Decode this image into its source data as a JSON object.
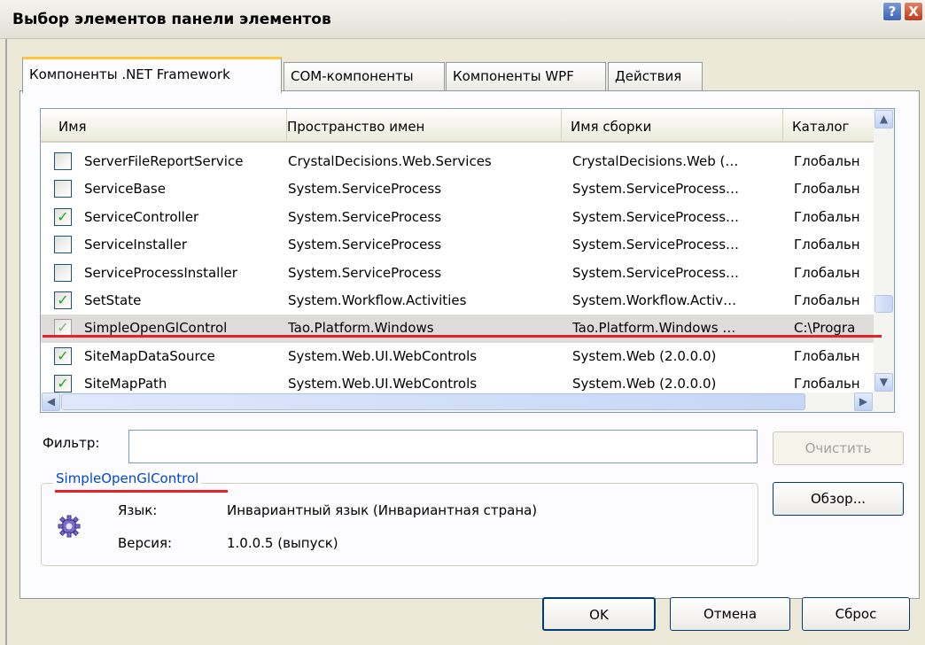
{
  "window": {
    "title": "Выбор элементов панели элементов",
    "help": "?",
    "close": "X"
  },
  "tabs": [
    {
      "label": "Компоненты .NET Framework",
      "active": true
    },
    {
      "label": "COM-компоненты",
      "active": false
    },
    {
      "label": "Компоненты WPF",
      "active": false
    },
    {
      "label": "Действия",
      "active": false
    }
  ],
  "columns": [
    "Имя",
    "Пространство имен",
    "Имя сборки",
    "Каталог"
  ],
  "rows": [
    {
      "checked": false,
      "name": "ServerFileReportService",
      "namespace": "CrystalDecisions.Web.Services",
      "assembly": "CrystalDecisions.Web (…",
      "dir": "Глобальн"
    },
    {
      "checked": false,
      "name": "ServiceBase",
      "namespace": "System.ServiceProcess",
      "assembly": "System.ServiceProcess…",
      "dir": "Глобальн"
    },
    {
      "checked": true,
      "name": "ServiceController",
      "namespace": "System.ServiceProcess",
      "assembly": "System.ServiceProcess…",
      "dir": "Глобальн"
    },
    {
      "checked": false,
      "name": "ServiceInstaller",
      "namespace": "System.ServiceProcess",
      "assembly": "System.ServiceProcess…",
      "dir": "Глобальн"
    },
    {
      "checked": false,
      "name": "ServiceProcessInstaller",
      "namespace": "System.ServiceProcess",
      "assembly": "System.ServiceProcess…",
      "dir": "Глобальн"
    },
    {
      "checked": true,
      "name": "SetState",
      "namespace": "System.Workflow.Activities",
      "assembly": "System.Workflow.Activ…",
      "dir": "Глобальн"
    },
    {
      "checked": true,
      "selected": true,
      "name": "SimpleOpenGlControl",
      "namespace": "Tao.Platform.Windows",
      "assembly": "Tao.Platform.Windows …",
      "dir": "C:\\Progra"
    },
    {
      "checked": true,
      "name": "SiteMapDataSource",
      "namespace": "System.Web.UI.WebControls",
      "assembly": "System.Web (2.0.0.0)",
      "dir": "Глобальн"
    },
    {
      "checked": true,
      "name": "SiteMapPath",
      "namespace": "System.Web.UI.WebControls",
      "assembly": "System.Web (2.0.0.0)",
      "dir": "Глобальн"
    }
  ],
  "filter": {
    "label": "Фильтр:",
    "value": "",
    "clear_label": "Очистить"
  },
  "details": {
    "title": "SimpleOpenGlControl",
    "language_label": "Язык:",
    "language_value": "Инвариантный язык (Инвариантная страна)",
    "version_label": "Версия:",
    "version_value": "1.0.0.5 (выпуск)",
    "icon": "gear-icon"
  },
  "buttons": {
    "browse": "Обзор...",
    "ok": "OK",
    "cancel": "Отмена",
    "reset": "Сброс"
  },
  "colors": {
    "highlight_line": "#e8202a",
    "check": "#21a121",
    "group_title": "#0046d5"
  }
}
